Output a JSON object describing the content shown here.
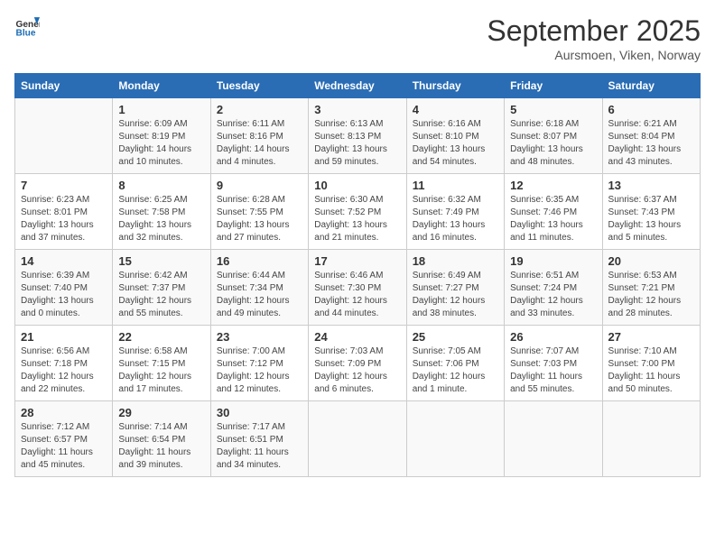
{
  "header": {
    "logo_line1": "General",
    "logo_line2": "Blue",
    "month": "September 2025",
    "location": "Aursmoen, Viken, Norway"
  },
  "weekdays": [
    "Sunday",
    "Monday",
    "Tuesday",
    "Wednesday",
    "Thursday",
    "Friday",
    "Saturday"
  ],
  "weeks": [
    [
      {
        "day": "",
        "info": ""
      },
      {
        "day": "1",
        "info": "Sunrise: 6:09 AM\nSunset: 8:19 PM\nDaylight: 14 hours\nand 10 minutes."
      },
      {
        "day": "2",
        "info": "Sunrise: 6:11 AM\nSunset: 8:16 PM\nDaylight: 14 hours\nand 4 minutes."
      },
      {
        "day": "3",
        "info": "Sunrise: 6:13 AM\nSunset: 8:13 PM\nDaylight: 13 hours\nand 59 minutes."
      },
      {
        "day": "4",
        "info": "Sunrise: 6:16 AM\nSunset: 8:10 PM\nDaylight: 13 hours\nand 54 minutes."
      },
      {
        "day": "5",
        "info": "Sunrise: 6:18 AM\nSunset: 8:07 PM\nDaylight: 13 hours\nand 48 minutes."
      },
      {
        "day": "6",
        "info": "Sunrise: 6:21 AM\nSunset: 8:04 PM\nDaylight: 13 hours\nand 43 minutes."
      }
    ],
    [
      {
        "day": "7",
        "info": "Sunrise: 6:23 AM\nSunset: 8:01 PM\nDaylight: 13 hours\nand 37 minutes."
      },
      {
        "day": "8",
        "info": "Sunrise: 6:25 AM\nSunset: 7:58 PM\nDaylight: 13 hours\nand 32 minutes."
      },
      {
        "day": "9",
        "info": "Sunrise: 6:28 AM\nSunset: 7:55 PM\nDaylight: 13 hours\nand 27 minutes."
      },
      {
        "day": "10",
        "info": "Sunrise: 6:30 AM\nSunset: 7:52 PM\nDaylight: 13 hours\nand 21 minutes."
      },
      {
        "day": "11",
        "info": "Sunrise: 6:32 AM\nSunset: 7:49 PM\nDaylight: 13 hours\nand 16 minutes."
      },
      {
        "day": "12",
        "info": "Sunrise: 6:35 AM\nSunset: 7:46 PM\nDaylight: 13 hours\nand 11 minutes."
      },
      {
        "day": "13",
        "info": "Sunrise: 6:37 AM\nSunset: 7:43 PM\nDaylight: 13 hours\nand 5 minutes."
      }
    ],
    [
      {
        "day": "14",
        "info": "Sunrise: 6:39 AM\nSunset: 7:40 PM\nDaylight: 13 hours\nand 0 minutes."
      },
      {
        "day": "15",
        "info": "Sunrise: 6:42 AM\nSunset: 7:37 PM\nDaylight: 12 hours\nand 55 minutes."
      },
      {
        "day": "16",
        "info": "Sunrise: 6:44 AM\nSunset: 7:34 PM\nDaylight: 12 hours\nand 49 minutes."
      },
      {
        "day": "17",
        "info": "Sunrise: 6:46 AM\nSunset: 7:30 PM\nDaylight: 12 hours\nand 44 minutes."
      },
      {
        "day": "18",
        "info": "Sunrise: 6:49 AM\nSunset: 7:27 PM\nDaylight: 12 hours\nand 38 minutes."
      },
      {
        "day": "19",
        "info": "Sunrise: 6:51 AM\nSunset: 7:24 PM\nDaylight: 12 hours\nand 33 minutes."
      },
      {
        "day": "20",
        "info": "Sunrise: 6:53 AM\nSunset: 7:21 PM\nDaylight: 12 hours\nand 28 minutes."
      }
    ],
    [
      {
        "day": "21",
        "info": "Sunrise: 6:56 AM\nSunset: 7:18 PM\nDaylight: 12 hours\nand 22 minutes."
      },
      {
        "day": "22",
        "info": "Sunrise: 6:58 AM\nSunset: 7:15 PM\nDaylight: 12 hours\nand 17 minutes."
      },
      {
        "day": "23",
        "info": "Sunrise: 7:00 AM\nSunset: 7:12 PM\nDaylight: 12 hours\nand 12 minutes."
      },
      {
        "day": "24",
        "info": "Sunrise: 7:03 AM\nSunset: 7:09 PM\nDaylight: 12 hours\nand 6 minutes."
      },
      {
        "day": "25",
        "info": "Sunrise: 7:05 AM\nSunset: 7:06 PM\nDaylight: 12 hours\nand 1 minute."
      },
      {
        "day": "26",
        "info": "Sunrise: 7:07 AM\nSunset: 7:03 PM\nDaylight: 11 hours\nand 55 minutes."
      },
      {
        "day": "27",
        "info": "Sunrise: 7:10 AM\nSunset: 7:00 PM\nDaylight: 11 hours\nand 50 minutes."
      }
    ],
    [
      {
        "day": "28",
        "info": "Sunrise: 7:12 AM\nSunset: 6:57 PM\nDaylight: 11 hours\nand 45 minutes."
      },
      {
        "day": "29",
        "info": "Sunrise: 7:14 AM\nSunset: 6:54 PM\nDaylight: 11 hours\nand 39 minutes."
      },
      {
        "day": "30",
        "info": "Sunrise: 7:17 AM\nSunset: 6:51 PM\nDaylight: 11 hours\nand 34 minutes."
      },
      {
        "day": "",
        "info": ""
      },
      {
        "day": "",
        "info": ""
      },
      {
        "day": "",
        "info": ""
      },
      {
        "day": "",
        "info": ""
      }
    ]
  ]
}
